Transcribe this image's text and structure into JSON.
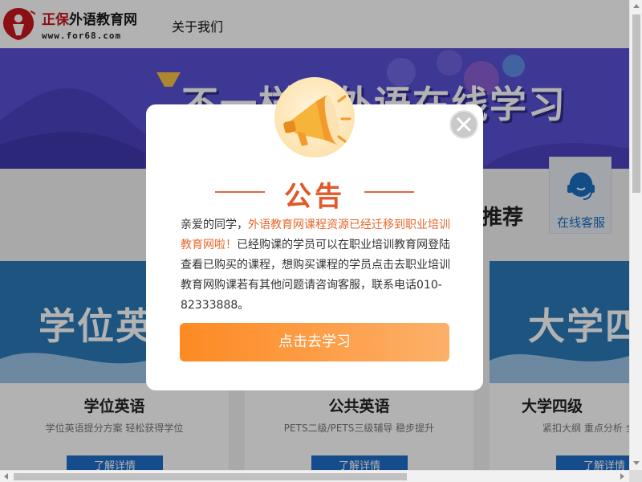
{
  "header": {
    "brand_red": "正保",
    "brand_black": "外语教育网",
    "url": "www.for68.com",
    "nav": [
      "关于我们"
    ]
  },
  "banner": {
    "title": "不一样的外语在线学习"
  },
  "section": {
    "title": "推荐"
  },
  "service": {
    "label": "在线客服"
  },
  "cards": [
    {
      "image_text": "学位英语",
      "title": "学位英语",
      "desc": "学位英语提分方案 轻松获得学位",
      "button": "了解详情"
    },
    {
      "image_text": "",
      "title": "公共英语",
      "desc": "PETS二级/PETS三级辅导 稳步提升",
      "button": "了解详情"
    },
    {
      "image_text": "大学四级",
      "title": "大学四级",
      "desc": "紧扣大纲 重点分析 全",
      "button": "了解详情"
    }
  ],
  "modal": {
    "heading": "公告",
    "body_prefix": "亲爱的同学，",
    "body_highlight": "外语教育网课程资源已经迁移到职业培训教育网啦！",
    "body_rest": "已经购课的学员可以在职业培训教育网登陆查看已购买的课程，想购买课程的学员点击去职业培训教育网购课若有其他问题请咨询客服，联系电话010-82333888。",
    "button": "点击去学习"
  },
  "colors": {
    "brand_red": "#c8161d",
    "banner_bg": "#5a51d6",
    "card_blue": "#2a79b8",
    "accent_orange": "#fd8a22",
    "heading_orange": "#e0592a",
    "link_blue": "#1b6fc2"
  },
  "icons": {
    "logo": "logo-mark-icon",
    "megaphone": "megaphone-icon",
    "close": "close-icon",
    "service": "headset-icon"
  }
}
